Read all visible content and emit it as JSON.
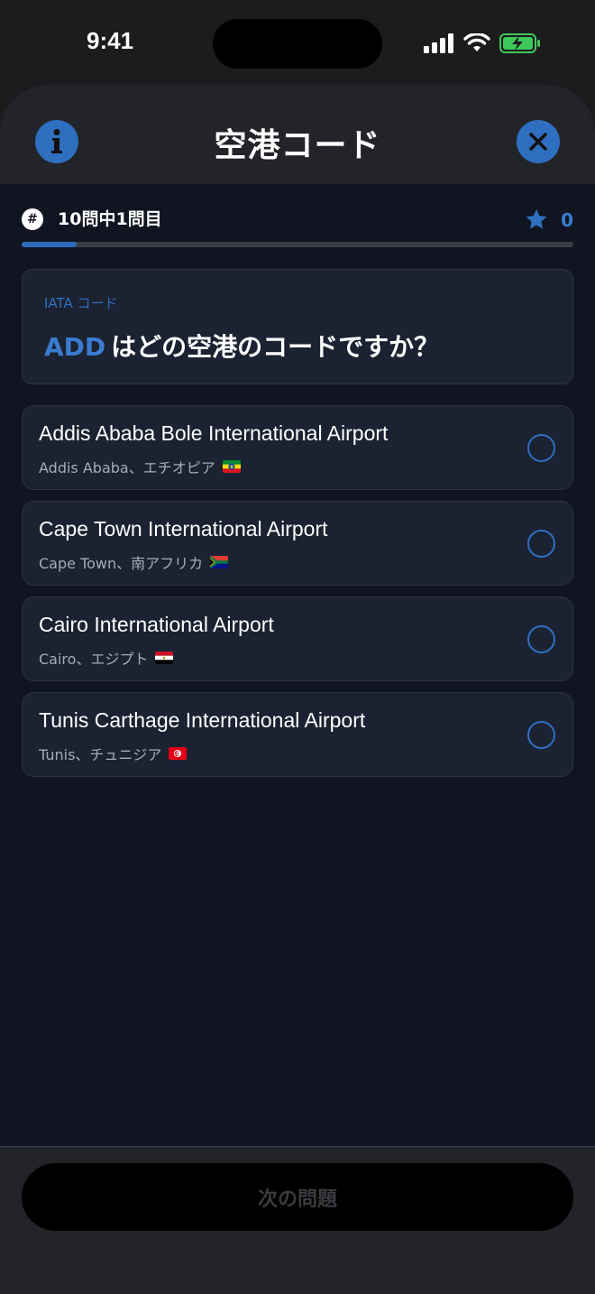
{
  "status_bar": {
    "time": "9:41"
  },
  "header": {
    "title": "空港コード",
    "info_icon": "info-icon",
    "close_icon": "close-icon"
  },
  "progress": {
    "badge": "#",
    "label": "10問中1問目",
    "current": 1,
    "total": 10,
    "score": "0"
  },
  "question": {
    "category": "IATA コード",
    "code": "ADD",
    "text": "はどの空港のコードですか？"
  },
  "options": [
    {
      "name": "Addis Ababa Bole International Airport",
      "location": "Addis Ababa、エチオピア",
      "flag": "ethiopia-flag"
    },
    {
      "name": "Cape Town International Airport",
      "location": "Cape Town、南アフリカ",
      "flag": "south-africa-flag"
    },
    {
      "name": "Cairo International Airport",
      "location": "Cairo、エジプト",
      "flag": "egypt-flag"
    },
    {
      "name": "Tunis Carthage International Airport",
      "location": "Tunis、チュニジア",
      "flag": "tunisia-flag"
    }
  ],
  "footer": {
    "next_label": "次の問題"
  },
  "colors": {
    "accent": "#2f6fc0",
    "background": "#111521",
    "card": "#1b2231"
  }
}
